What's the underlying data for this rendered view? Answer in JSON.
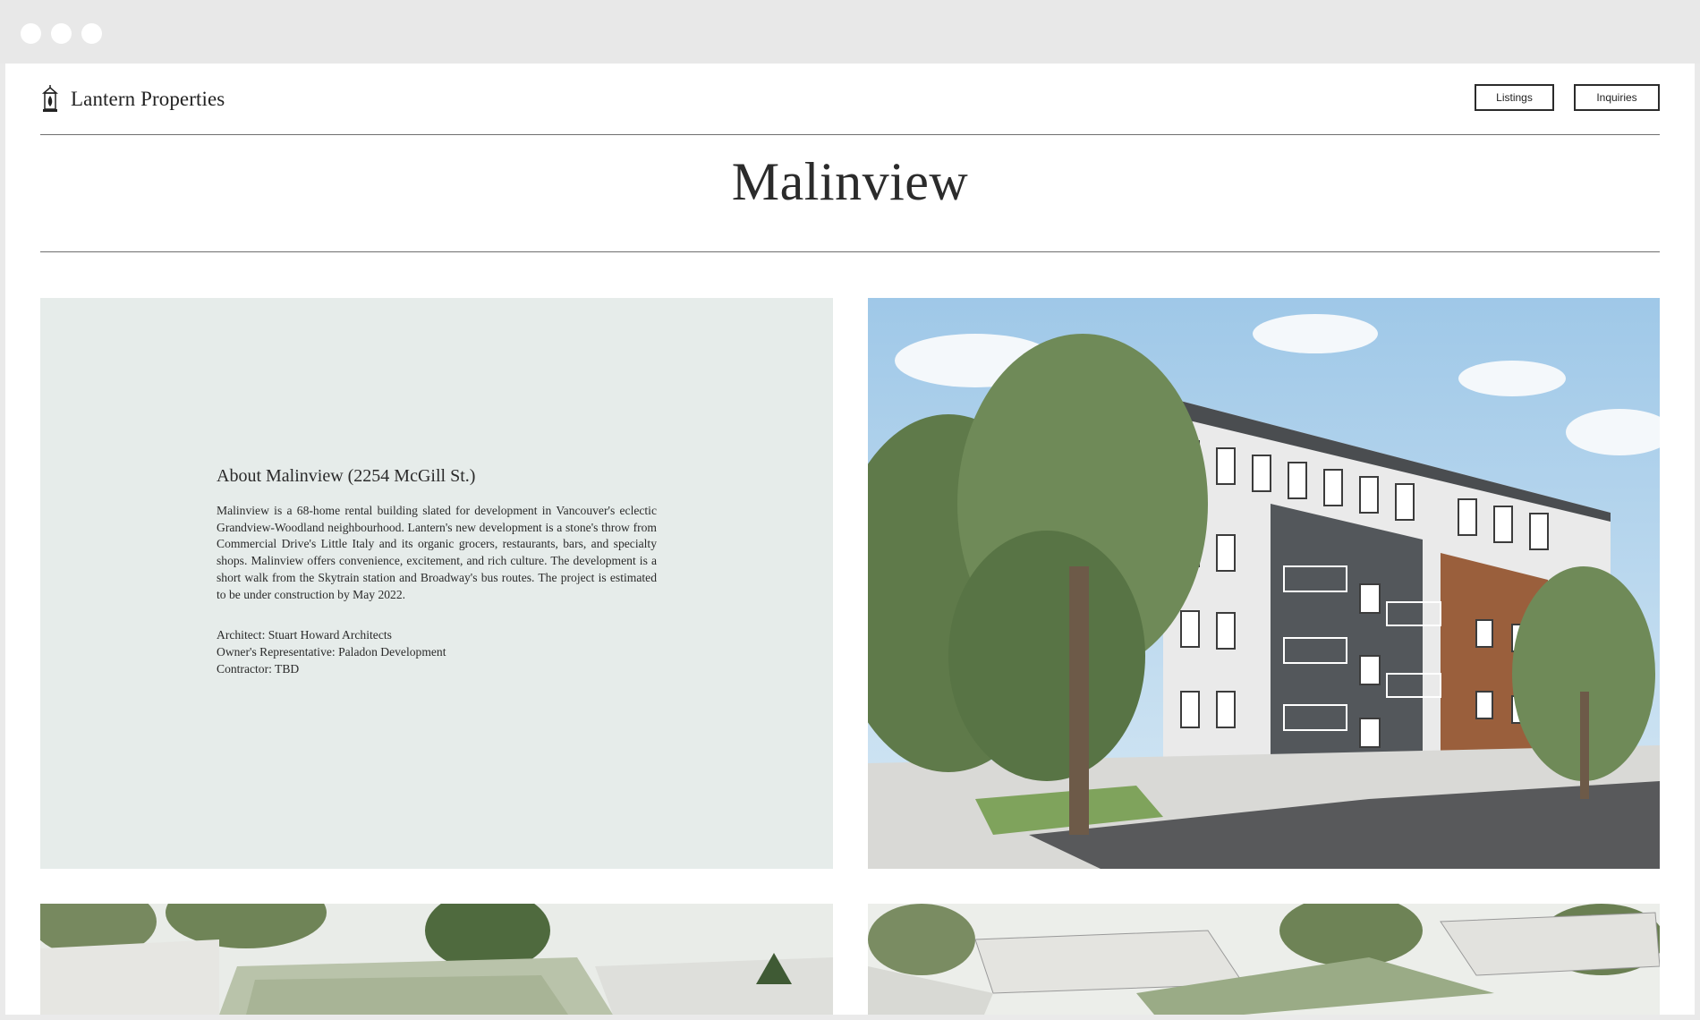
{
  "window": {
    "controls": [
      "close-dot",
      "minimize-dot",
      "maximize-dot"
    ]
  },
  "header": {
    "brand_name": "Lantern Properties",
    "brand_icon": "lantern-icon",
    "nav": {
      "listings_label": "Listings",
      "inquiries_label": "Inquiries"
    }
  },
  "page": {
    "title": "Malinview"
  },
  "about": {
    "heading": "About Malinview (2254 McGill St.)",
    "body": "Malinview is a 68-home rental building slated for development in Vancouver's eclectic Grandview-Woodland neighbourhood. Lantern's new development is a stone's throw from Commercial Drive's Little Italy and its organic grocers, restaurants, bars, and specialty shops. Malinview offers convenience, excitement, and rich culture. The development is a short walk from the Skytrain station and Broadway's bus routes. The project is estimated to be under construction by May 2022.",
    "credits": {
      "architect": "Architect: Stuart Howard Architects",
      "owners_rep": "Owner's Representative: Paladon Development",
      "contractor": "Contractor: TBD"
    }
  },
  "gallery": {
    "hero_image": "building-rendering-image",
    "thumbnails": [
      "aerial-rendering-image-1",
      "aerial-rendering-image-2"
    ]
  },
  "colors": {
    "about_panel_bg": "#e6ecea",
    "chrome_bg": "#e8e8e8",
    "text": "#2a2a2a"
  }
}
